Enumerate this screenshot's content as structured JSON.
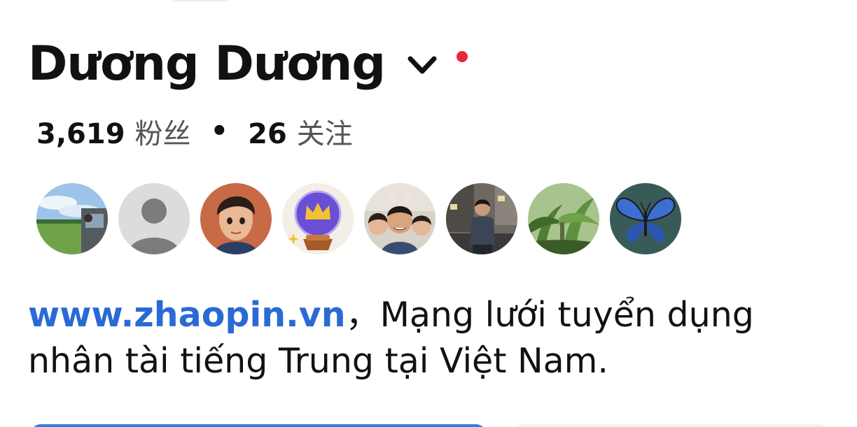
{
  "profile": {
    "name": "Dương Dương",
    "notification_dot_color": "#e8263c"
  },
  "stats": {
    "followers_count": "3,619",
    "followers_label": "粉丝",
    "separator": "•",
    "following_count": "26",
    "following_label": "关注"
  },
  "friend_avatars": [
    {
      "icon": "landscape-photo-avatar"
    },
    {
      "icon": "default-user-avatar"
    },
    {
      "icon": "animated-character-avatar"
    },
    {
      "icon": "crystal-ball-crown-avatar"
    },
    {
      "icon": "group-selfie-avatar"
    },
    {
      "icon": "man-street-photo-avatar"
    },
    {
      "icon": "banana-plants-avatar"
    },
    {
      "icon": "butterfly-avatar"
    }
  ],
  "bio": {
    "link_text": "www.zhaopin.vn",
    "comma": "，",
    "text": "Mạng lưới tuyển dụng nhân tài tiếng Trung tại Việt Nam."
  },
  "colors": {
    "link": "#2a6ad4",
    "primary_button": "#2f7fe0"
  }
}
